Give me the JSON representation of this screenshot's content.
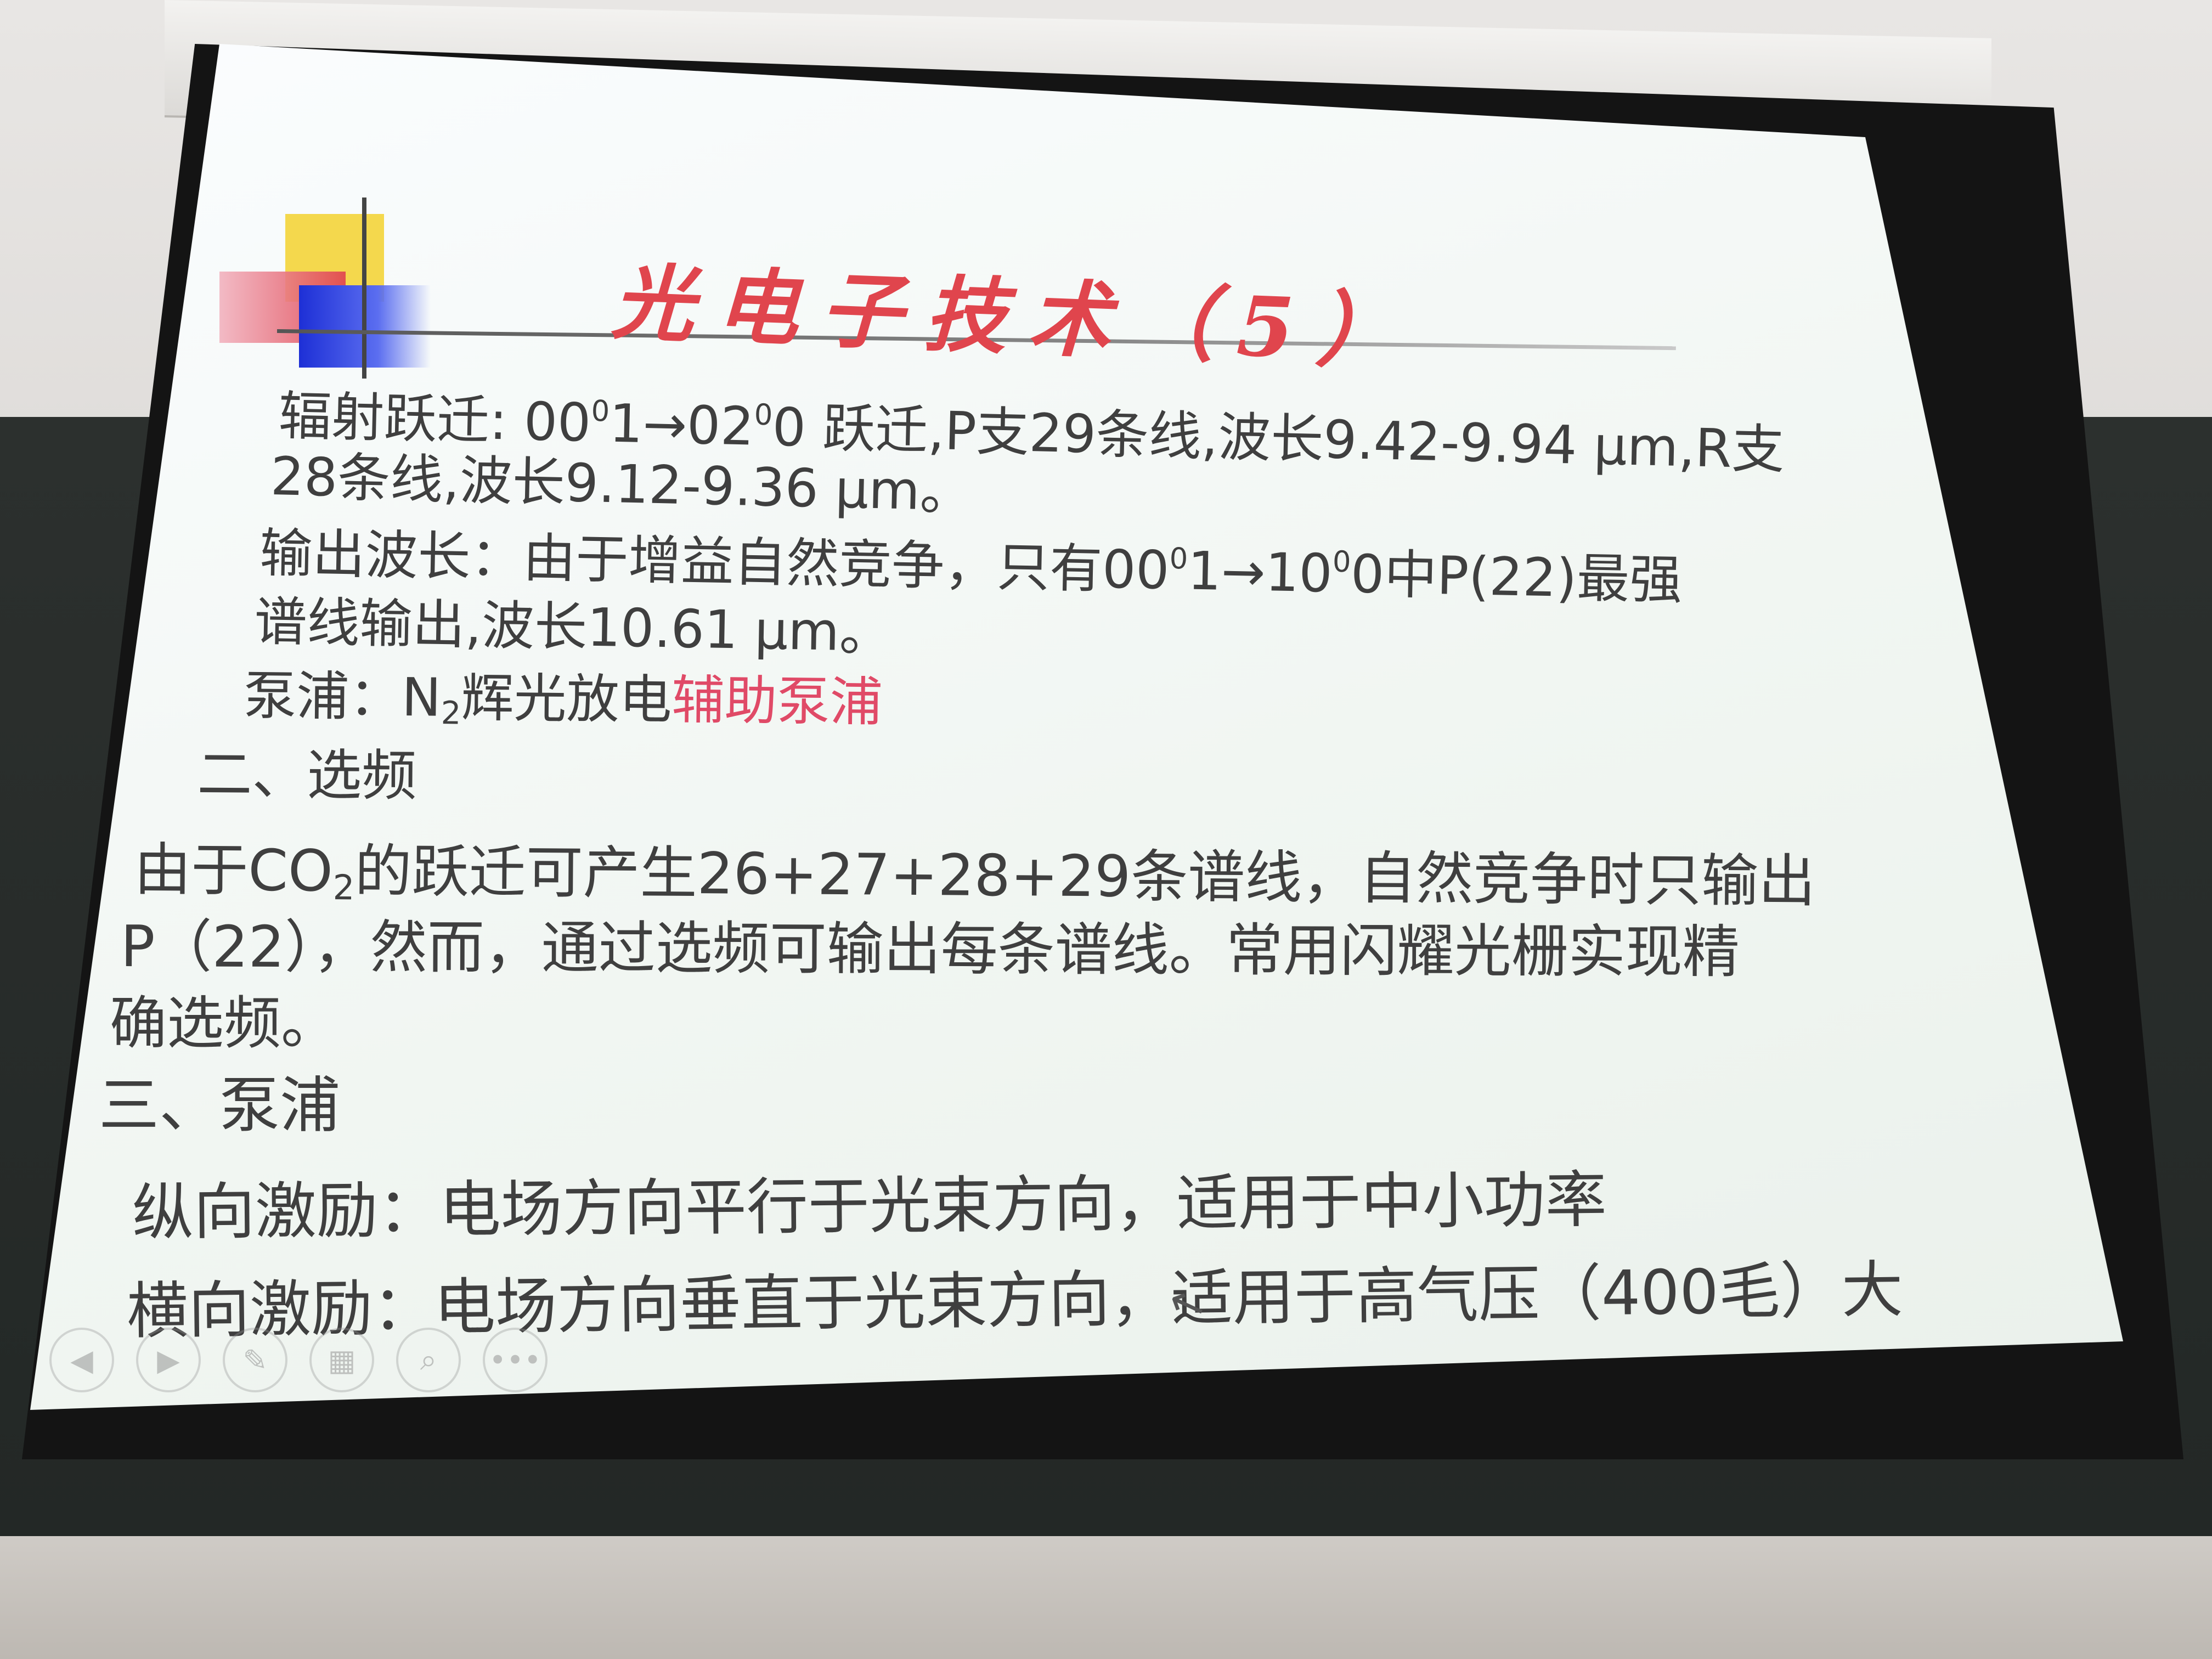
{
  "slide": {
    "title": "光电子技术（5）",
    "line1": {
      "pre": "辐射跃迁: 00",
      "sup1": "0",
      "mid1": "1→02",
      "sup2": "0",
      "post": "0 跃迁,P支29条线,波长9.42-9.94 μm,R支"
    },
    "line2": "28条线,波长9.12-9.36 μm。",
    "line3": {
      "pre": "输出波长：由于增益自然竞争，只有00",
      "sup1": "0",
      "mid1": "1→10",
      "sup2": "0",
      "post": "0中P(22)最强"
    },
    "line4": "谱线输出,波长10.61 μm。",
    "line5": {
      "pre": "泵浦：N",
      "sub": "2",
      "mid": "辉光放电",
      "highlight": "辅助泵浦"
    },
    "heading2": "二、选频",
    "line7": {
      "pre": "由于CO",
      "sub": "2",
      "post": "的跃迁可产生26+27+28+29条谱线，自然竞争时只输出"
    },
    "line8": "P（22），然而，通过选频可输出每条谱线。常用闪耀光栅实现精",
    "line9": "确选频。",
    "heading3": "三、泵浦",
    "line11": "纵向激励：电场方向平行于光束方向，适用于中小功率",
    "line12": "横向激励：电场方向垂直于光束方向，适用于高气压（400毛）大"
  },
  "colors": {
    "title": "#e0454d",
    "highlight": "#e04a67",
    "text": "#3f3f3f"
  },
  "controls": [
    "previous-icon",
    "next-icon",
    "pen-icon",
    "slides-icon",
    "zoom-icon",
    "more-icon"
  ]
}
